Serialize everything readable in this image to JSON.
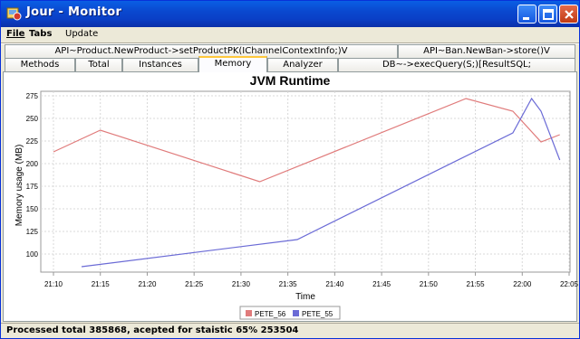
{
  "window": {
    "title": "Jour - Monitor",
    "accent_color": "#0a48cf"
  },
  "menubar": {
    "items": [
      {
        "label": "File"
      },
      {
        "label": "Tabs"
      },
      {
        "label": "Update"
      }
    ]
  },
  "tabs_row1": [
    {
      "label": "API~Product.NewProduct->setProductPK(IChannelContextInfo;)V",
      "selected": false
    },
    {
      "label": "API~Ban.NewBan->store()V",
      "selected": false
    }
  ],
  "tabs_row2": [
    {
      "label": "Methods",
      "selected": false
    },
    {
      "label": "Total",
      "selected": false
    },
    {
      "label": "Instances",
      "selected": false
    },
    {
      "label": "Memory",
      "selected": true
    },
    {
      "label": "Analyzer",
      "selected": false
    },
    {
      "label": "DB~->execQuery(S;)[ResultSQL;",
      "selected": false
    }
  ],
  "status": {
    "text": "Processed total 385868, acepted for staistic  65% 253504"
  },
  "chart_data": {
    "type": "line",
    "title": "JVM Runtime",
    "xlabel": "Time",
    "ylabel": "Memory usage (MB)",
    "x_tick_labels": [
      "21:10",
      "21:15",
      "21:20",
      "21:25",
      "21:30",
      "21:35",
      "21:40",
      "21:45",
      "21:50",
      "21:55",
      "22:00",
      "22:05"
    ],
    "y_tick_labels": [
      "100",
      "125",
      "150",
      "175",
      "200",
      "225",
      "250",
      "275"
    ],
    "xlim_minutes": [
      0,
      55
    ],
    "ylim": [
      80,
      280
    ],
    "grid": true,
    "legend_position": "bottom",
    "series": [
      {
        "name": "PETE_56",
        "color": "#e07b7b",
        "points": [
          {
            "x": "21:10",
            "y": 213
          },
          {
            "x": "21:15",
            "y": 237
          },
          {
            "x": "21:32",
            "y": 180
          },
          {
            "x": "21:54",
            "y": 272
          },
          {
            "x": "21:59",
            "y": 258
          },
          {
            "x": "22:02",
            "y": 224
          },
          {
            "x": "22:04",
            "y": 232
          }
        ]
      },
      {
        "name": "PETE_55",
        "color": "#6b6bd6",
        "points": [
          {
            "x": "21:13",
            "y": 86
          },
          {
            "x": "21:36",
            "y": 116
          },
          {
            "x": "21:59",
            "y": 234
          },
          {
            "x": "22:01",
            "y": 272
          },
          {
            "x": "22:02",
            "y": 258
          },
          {
            "x": "22:04",
            "y": 204
          }
        ]
      }
    ]
  }
}
